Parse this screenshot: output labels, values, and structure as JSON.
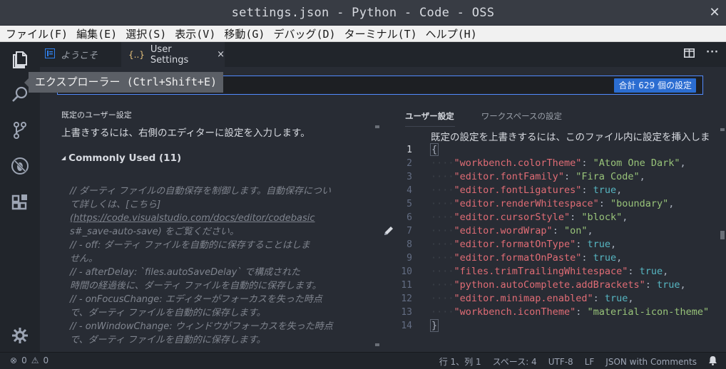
{
  "window": {
    "title": "settings.json - Python - Code - OSS"
  },
  "menu": [
    "ファイル(F)",
    "編集(E)",
    "選択(S)",
    "表示(V)",
    "移動(G)",
    "デバッグ(D)",
    "ターミナル(T)",
    "ヘルプ(H)"
  ],
  "tooltip": "エクスプローラー (Ctrl+Shift+E)",
  "tabs": [
    {
      "label": "ようこそ",
      "icon": "vscode-welcome-icon"
    },
    {
      "label": "User Settings",
      "icon": "json-braces-icon",
      "close": "×"
    }
  ],
  "search": {
    "count_badge": "合計 629 個の設定"
  },
  "default_settings": {
    "title": "既定のユーザー設定",
    "hint": "上書きするには、右側のエディターに設定を入力します。",
    "section": "Commonly Used (11)",
    "comment_lines": [
      "// ダーティ ファイルの自動保存を制御します。自動保存につい",
      "て詳しくは、[こちら]",
      "(https://code.visualstudio.com/docs/editor/codebasic",
      "s#_save-auto-save) をご覧ください。",
      "//  - off: ダーティ ファイルを自動的に保存することはしま",
      "せん。",
      "//  - afterDelay: `files.autoSaveDelay` で構成された",
      "時間の経過後に、ダーティ ファイルを自動的に保存します。",
      "//  - onFocusChange: エディターがフォーカスを失った時点",
      "で、ダーティ ファイルを自動的に保存します。",
      "//  - onWindowChange: ウィンドウがフォーカスを失った時点",
      "で、ダーティ ファイルを自動的に保存します。"
    ]
  },
  "user_settings": {
    "tabs": [
      "ユーザー設定",
      "ワークスペースの設定"
    ],
    "hint": "既定の設定を上書きするには、このファイル内に設定を挿入しま",
    "line_numbers": [
      "1",
      "2",
      "3",
      "4",
      "5",
      "6",
      "7",
      "8",
      "9",
      "10",
      "11",
      "12",
      "13",
      "14"
    ],
    "open_brace": "{",
    "close_brace": "}",
    "entries": [
      {
        "key": "\"workbench.colorTheme\"",
        "value": "\"Atom One Dark\"",
        "type": "string"
      },
      {
        "key": "\"editor.fontFamily\"",
        "value": "\"Fira Code\"",
        "type": "string"
      },
      {
        "key": "\"editor.fontLigatures\"",
        "value": "true",
        "type": "bool"
      },
      {
        "key": "\"editor.renderWhitespace\"",
        "value": "\"boundary\"",
        "type": "string"
      },
      {
        "key": "\"editor.cursorStyle\"",
        "value": "\"block\"",
        "type": "string"
      },
      {
        "key": "\"editor.wordWrap\"",
        "value": "\"on\"",
        "type": "string"
      },
      {
        "key": "\"editor.formatOnType\"",
        "value": "true",
        "type": "bool"
      },
      {
        "key": "\"editor.formatOnPaste\"",
        "value": "true",
        "type": "bool"
      },
      {
        "key": "\"files.trimTrailingWhitespace\"",
        "value": "true",
        "type": "bool"
      },
      {
        "key": "\"python.autoComplete.addBrackets\"",
        "value": "true",
        "type": "bool"
      },
      {
        "key": "\"editor.minimap.enabled\"",
        "value": "true",
        "type": "bool"
      },
      {
        "key": "\"workbench.iconTheme\"",
        "value": "\"material-icon-theme\"",
        "type": "string"
      }
    ]
  },
  "status": {
    "errors": "0",
    "warnings": "0",
    "position": "行 1、列 1",
    "spaces": "スペース: 4",
    "encoding": "UTF-8",
    "eol": "LF",
    "language": "JSON with Comments"
  },
  "colors": {
    "accent": "#528bff",
    "badge": "#2b6dd1",
    "key": "#e06c75",
    "string": "#98c379",
    "bool": "#56b6c2"
  }
}
